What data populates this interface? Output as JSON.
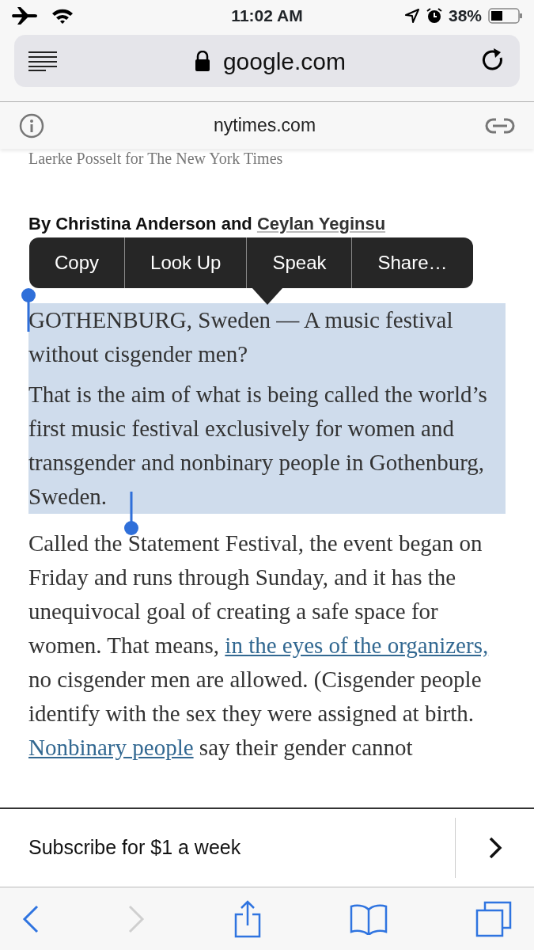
{
  "status_bar": {
    "time": "11:02 AM",
    "battery": "38%"
  },
  "address_bar": {
    "url": "google.com"
  },
  "site_bar": {
    "domain": "nytimes.com"
  },
  "article": {
    "caption": "Laerke Posselt for The New York Times",
    "byline": [
      {
        "kind": "plain",
        "text": "By Christina Anderson and "
      },
      {
        "kind": "link",
        "text": "Ceylan Yeginsu"
      }
    ],
    "paragraphs": [
      {
        "selected": true,
        "segments": [
          {
            "kind": "plain",
            "text": "GOTHENBURG, Sweden — A music festival without cisgender men?"
          }
        ]
      },
      {
        "selected": true,
        "segments": [
          {
            "kind": "plain",
            "text": "That is the aim of what is being called the world’s first music festival exclusively for women and transgender and nonbinary people in Gothenburg, Sweden."
          }
        ]
      },
      {
        "selected": false,
        "segments": [
          {
            "kind": "plain",
            "text": "Called the Statement Festival, the event began on Friday and runs through Sunday, and it has the unequivocal goal of creating a safe space for women. That means, "
          },
          {
            "kind": "link",
            "text": "in the eyes of the organizers,"
          },
          {
            "kind": "plain",
            "text": " no cisgender men are allowed. (Cisgender people identify with the sex they were assigned at birth. "
          },
          {
            "kind": "link",
            "text": "Nonbinary people"
          },
          {
            "kind": "plain",
            "text": " say their gender cannot"
          }
        ]
      }
    ]
  },
  "context_menu": [
    "Copy",
    "Look Up",
    "Speak",
    "Share…"
  ],
  "subscribe_banner": {
    "text": "Subscribe for $1 a week"
  },
  "toolbar": {
    "back_disabled": false,
    "forward_disabled": true
  }
}
